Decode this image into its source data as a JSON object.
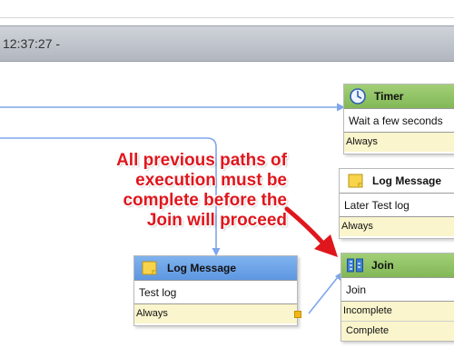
{
  "header": {
    "time_text": "12:37:27 -"
  },
  "nodes": {
    "timer": {
      "title": "Timer",
      "description": "Wait a few seconds",
      "outputs": [
        "Always"
      ]
    },
    "log_later": {
      "title": "Log Message",
      "description": "Later Test log",
      "outputs": [
        "Always"
      ]
    },
    "join": {
      "title": "Join",
      "description": "Join",
      "outputs": [
        "Incomplete",
        "Complete"
      ]
    },
    "log_test": {
      "title": "Log Message",
      "description": "Test log",
      "outputs": [
        "Always"
      ]
    }
  },
  "annotation": {
    "lines": [
      "All previous paths of",
      "execution must be",
      "complete before the",
      "Join will proceed"
    ],
    "color": "#e0161d"
  },
  "colors": {
    "connector": "#7ea6ea",
    "green_header": "#8cc161",
    "blue_header": "#6aa0e6",
    "output_bg": "#faf5cc",
    "port": "#f2b711"
  },
  "icons": {
    "timer": "clock-icon",
    "log": "note-icon",
    "join": "join-icon"
  }
}
